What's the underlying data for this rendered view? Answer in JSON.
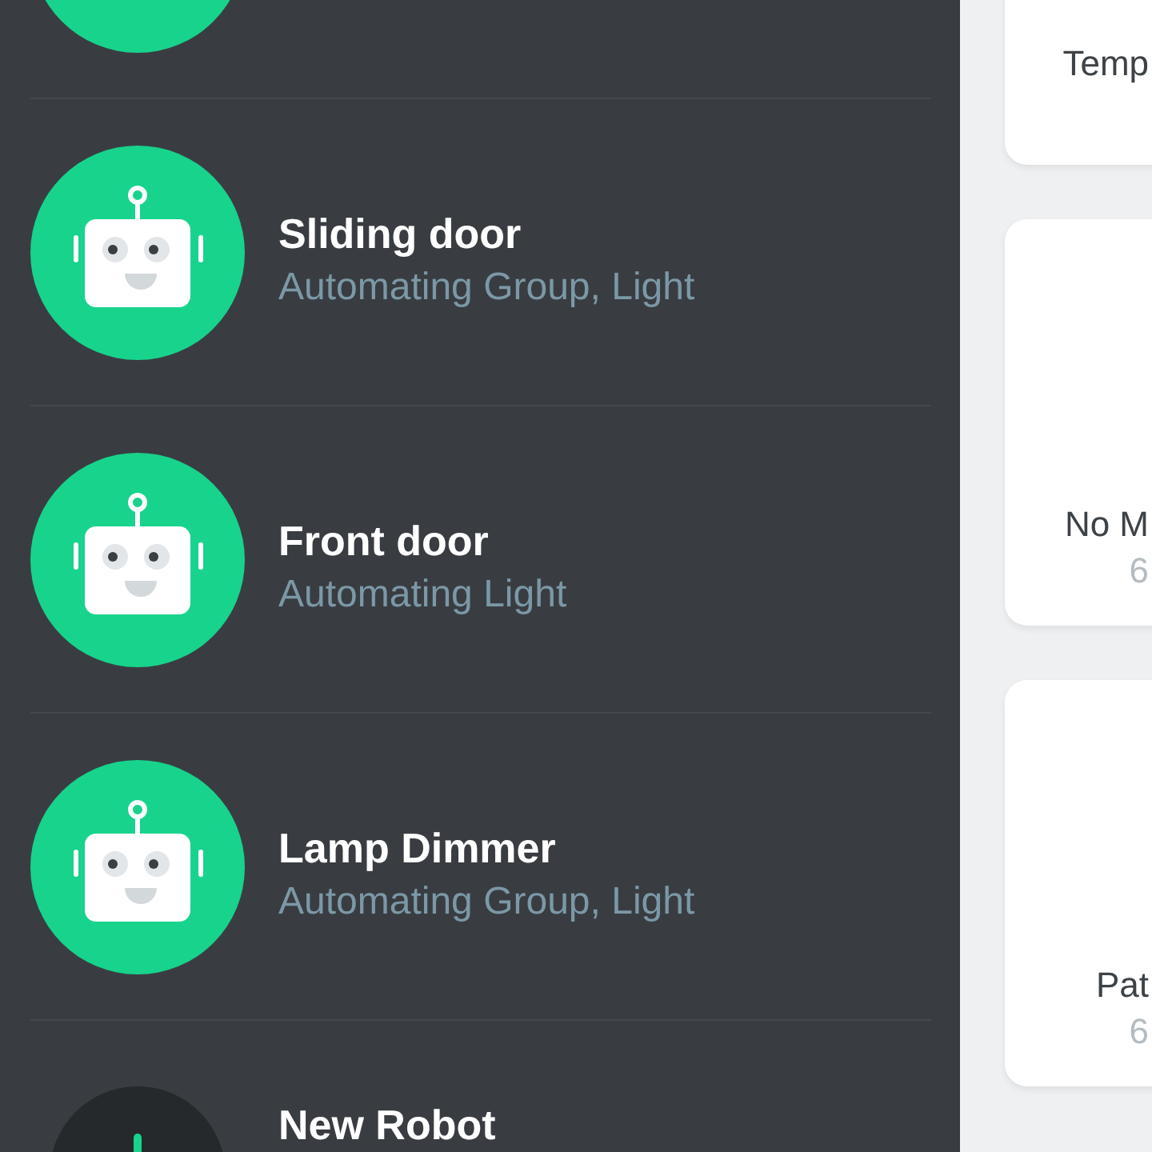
{
  "robots": [
    {
      "kind": "robot"
    },
    {
      "kind": "robot",
      "name": "Sliding door",
      "description": "Automating Group, Light"
    },
    {
      "kind": "robot",
      "name": "Front door",
      "description": "Automating Light"
    },
    {
      "kind": "robot",
      "name": "Lamp Dimmer",
      "description": "Automating Group, Light"
    },
    {
      "kind": "add",
      "name": "New Robot"
    }
  ],
  "cards": [
    {
      "title": "Temp"
    },
    {
      "title": "No M",
      "subtitle": "6"
    },
    {
      "title": "Pat",
      "subtitle": "6"
    }
  ]
}
